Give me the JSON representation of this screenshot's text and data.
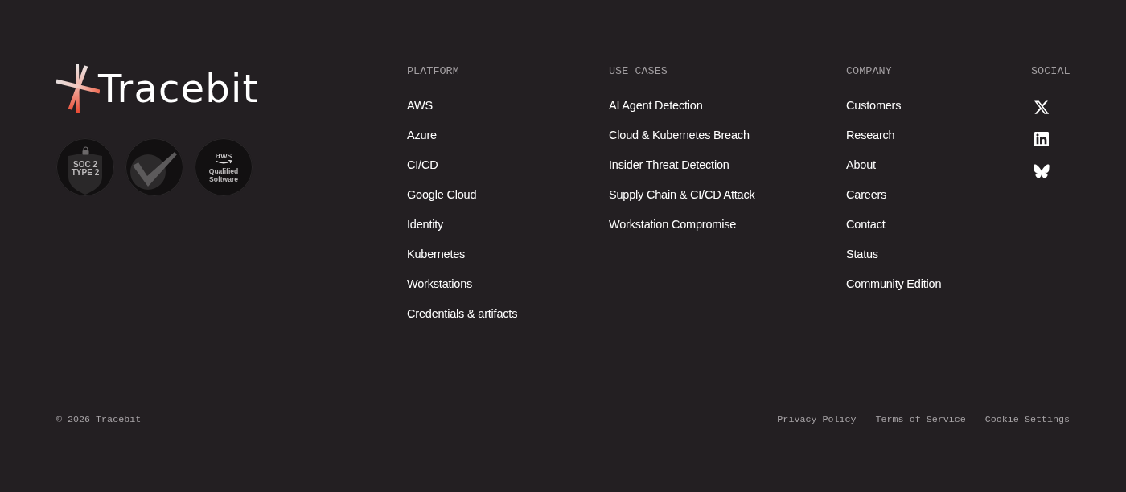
{
  "brand": {
    "name": "Tracebit"
  },
  "badges": [
    {
      "kind": "soc",
      "lines": [
        "SOC 2",
        "TYPE 2"
      ]
    },
    {
      "kind": "check"
    },
    {
      "kind": "aws",
      "mark": "aws",
      "lines": [
        "Qualified",
        "Software"
      ]
    }
  ],
  "columns": [
    {
      "heading": "PLATFORM",
      "links": [
        "AWS",
        "Azure",
        "CI/CD",
        "Google Cloud",
        "Identity",
        "Kubernetes",
        "Workstations",
        "Credentials & artifacts"
      ]
    },
    {
      "heading": "USE CASES",
      "links": [
        "AI Agent Detection",
        "Cloud & Kubernetes Breach",
        "Insider Threat Detection",
        "Supply Chain & CI/CD Attack",
        "Workstation Compromise"
      ]
    },
    {
      "heading": "COMPANY",
      "links": [
        "Customers",
        "Research",
        "About",
        "Careers",
        "Contact",
        "Status",
        "Community Edition"
      ]
    }
  ],
  "social": {
    "heading": "SOCIAL",
    "links": [
      {
        "kind": "x"
      },
      {
        "kind": "linkedin"
      },
      {
        "kind": "bluesky"
      }
    ]
  },
  "copyright": "© 2026 Tracebit",
  "legal_links": [
    "Privacy Policy",
    "Terms of Service",
    "Cookie Settings"
  ]
}
